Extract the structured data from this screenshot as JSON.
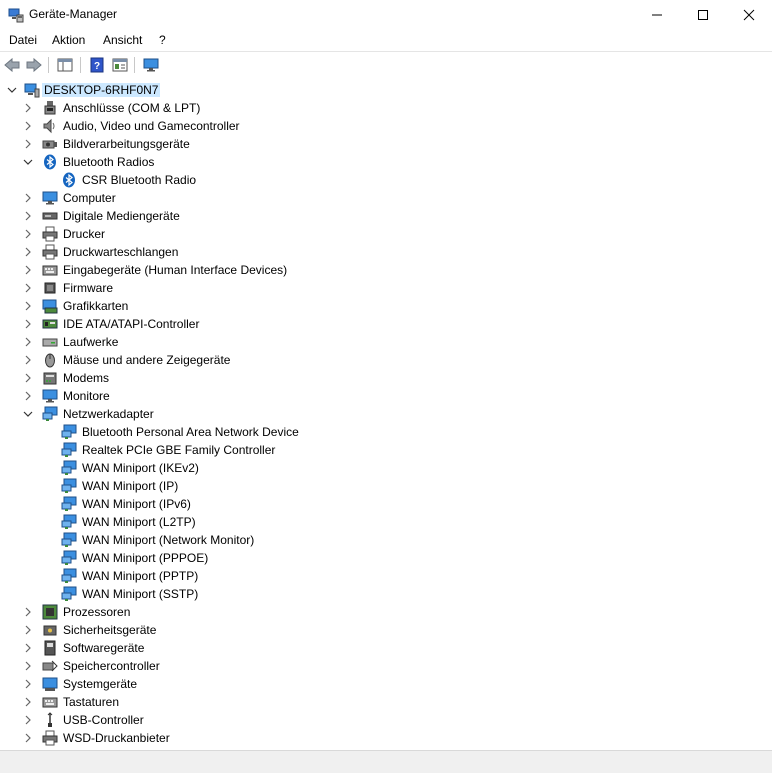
{
  "window": {
    "title": "Geräte-Manager"
  },
  "menu": [
    "Datei",
    "Aktion",
    "Ansicht",
    "?"
  ],
  "tree": {
    "root": "DESKTOP-6RHF0N7",
    "rows": [
      {
        "label": "Anschlüsse (COM & LPT)",
        "level": 1,
        "expanded": false,
        "icon": "port-icon"
      },
      {
        "label": "Audio, Video und Gamecontroller",
        "level": 1,
        "expanded": false,
        "icon": "speaker-icon"
      },
      {
        "label": "Bildverarbeitungsgeräte",
        "level": 1,
        "expanded": false,
        "icon": "camera-icon"
      },
      {
        "label": "Bluetooth Radios",
        "level": 1,
        "expanded": true,
        "icon": "bluetooth-icon"
      },
      {
        "label": "CSR Bluetooth Radio",
        "level": 2,
        "icon": "bluetooth-icon"
      },
      {
        "label": "Computer",
        "level": 1,
        "expanded": false,
        "icon": "computer-icon"
      },
      {
        "label": "Digitale Mediengeräte",
        "level": 1,
        "expanded": false,
        "icon": "media-device-icon"
      },
      {
        "label": "Drucker",
        "level": 1,
        "expanded": false,
        "icon": "printer-icon"
      },
      {
        "label": "Druckwarteschlangen",
        "level": 1,
        "expanded": false,
        "icon": "printer-icon"
      },
      {
        "label": "Eingabegeräte (Human Interface Devices)",
        "level": 1,
        "expanded": false,
        "icon": "keyboard-icon"
      },
      {
        "label": "Firmware",
        "level": 1,
        "expanded": false,
        "icon": "chip-icon"
      },
      {
        "label": "Grafikkarten",
        "level": 1,
        "expanded": false,
        "icon": "display-adapter-icon"
      },
      {
        "label": "IDE ATA/ATAPI-Controller",
        "level": 1,
        "expanded": false,
        "icon": "controller-icon"
      },
      {
        "label": "Laufwerke",
        "level": 1,
        "expanded": false,
        "icon": "drive-icon"
      },
      {
        "label": "Mäuse und andere Zeigegeräte",
        "level": 1,
        "expanded": false,
        "icon": "mouse-icon"
      },
      {
        "label": "Modems",
        "level": 1,
        "expanded": false,
        "icon": "modem-icon"
      },
      {
        "label": "Monitore",
        "level": 1,
        "expanded": false,
        "icon": "monitor-icon"
      },
      {
        "label": "Netzwerkadapter",
        "level": 1,
        "expanded": true,
        "icon": "network-icon"
      },
      {
        "label": "Bluetooth Personal Area Network Device",
        "level": 2,
        "icon": "network-icon"
      },
      {
        "label": "Realtek PCIe GBE Family Controller",
        "level": 2,
        "icon": "network-icon"
      },
      {
        "label": "WAN Miniport (IKEv2)",
        "level": 2,
        "icon": "network-icon"
      },
      {
        "label": "WAN Miniport (IP)",
        "level": 2,
        "icon": "network-icon"
      },
      {
        "label": "WAN Miniport (IPv6)",
        "level": 2,
        "icon": "network-icon"
      },
      {
        "label": "WAN Miniport (L2TP)",
        "level": 2,
        "icon": "network-icon"
      },
      {
        "label": "WAN Miniport (Network Monitor)",
        "level": 2,
        "icon": "network-icon"
      },
      {
        "label": "WAN Miniport (PPPOE)",
        "level": 2,
        "icon": "network-icon"
      },
      {
        "label": "WAN Miniport (PPTP)",
        "level": 2,
        "icon": "network-icon"
      },
      {
        "label": "WAN Miniport (SSTP)",
        "level": 2,
        "icon": "network-icon"
      },
      {
        "label": "Prozessoren",
        "level": 1,
        "expanded": false,
        "icon": "processor-icon"
      },
      {
        "label": "Sicherheitsgeräte",
        "level": 1,
        "expanded": false,
        "icon": "security-icon"
      },
      {
        "label": "Softwaregeräte",
        "level": 1,
        "expanded": false,
        "icon": "software-device-icon"
      },
      {
        "label": "Speichercontroller",
        "level": 1,
        "expanded": false,
        "icon": "storage-controller-icon"
      },
      {
        "label": "Systemgeräte",
        "level": 1,
        "expanded": false,
        "icon": "system-device-icon"
      },
      {
        "label": "Tastaturen",
        "level": 1,
        "expanded": false,
        "icon": "keyboard-icon"
      },
      {
        "label": "USB-Controller",
        "level": 1,
        "expanded": false,
        "icon": "usb-icon"
      },
      {
        "label": "WSD-Druckanbieter",
        "level": 1,
        "expanded": false,
        "icon": "printer-icon"
      }
    ]
  }
}
